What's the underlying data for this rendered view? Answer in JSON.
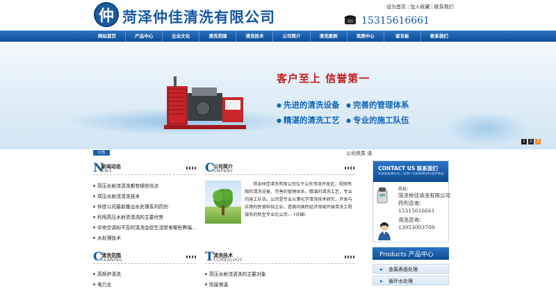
{
  "header": {
    "logo_char": "仲",
    "company_name": "菏泽仲佳清洗有限公司",
    "phone": "15315616661",
    "top_links": [
      "设为首页",
      "加入收藏",
      "联系我们"
    ]
  },
  "nav": {
    "items": [
      "网站首页",
      "产品中心",
      "企业文化",
      "清洗范围",
      "清洗技术",
      "公司简介",
      "清洗案例",
      "资质中心",
      "留言板",
      "联系我们"
    ]
  },
  "banner": {
    "slogan_main": "客户至上 信誉第一",
    "slogan_lines": [
      "先进的清洗设备",
      "完善的管理体系",
      "精湛的清洗工艺",
      "专业的施工队伍"
    ],
    "page_dots": [
      "1",
      "2",
      "3"
    ]
  },
  "ticker": {
    "label": "公告",
    "text": "公司资质         请"
  },
  "news": {
    "letter": "N",
    "title_cn": "新闻动态",
    "title_en": "EWS",
    "items": [
      "高压水射流清洗都有哪些优点",
      "高压水射流清洗技术",
      "仲佳公司最新推出水处理系列药剂",
      "利用高压水射流清洗的主要优势",
      "中央空调如不及时清洗会给生活带来哪些弊端...",
      "水处理技术"
    ]
  },
  "company": {
    "letter": "C",
    "title_cn": "公司简介",
    "title_en": "OMPANY",
    "text": "菏泽仲佳清洗有限公司位于山东菏泽开发区，视频有限的清洗设备，完善的管理体系，精湛的清洗工艺，专业的施工队伍。公司是专业从事化学清洗技术研究，开发与应用的民营科技企业，是面向国民经济领域开展清洗工程服务的新型专业化公司--- (详细)"
  },
  "scope": {
    "letter": "C",
    "title_cn": "清洗范围",
    "title_en": "LEANING",
    "items": [
      "高频炉清洗",
      "电力业"
    ]
  },
  "tech": {
    "letter": "T",
    "title_cn": "清洗技术",
    "title_en": "ECHNOLOGY",
    "items": [
      "高压水射流清洗的主要对象",
      "防腐保温"
    ]
  },
  "contact": {
    "title": "CONTACT US  联系我们",
    "subtitle": "欢迎您来我公司，咨询一切有关清洗的业务事宜",
    "hotline_label": "热线：",
    "company": "菏泽仲佳清洗有限公司",
    "person1": "药剂咨询：",
    "phone1": "15315616661",
    "person2": "清洗咨询：",
    "phone2": "13953003709"
  },
  "products": {
    "title": "Products  产品中心",
    "items": [
      "金属表面处理",
      "循环水处理"
    ]
  },
  "colors": {
    "brand_blue": "#1457a2",
    "nav_blue": "#0b4b93",
    "slogan_red": "#c31b1b",
    "active_dot": "#f08a24"
  }
}
